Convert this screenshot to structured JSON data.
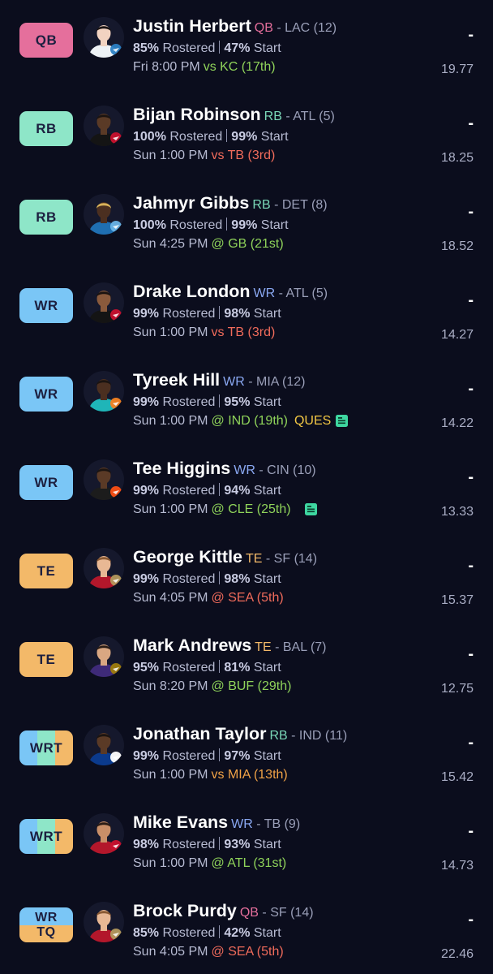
{
  "colors": {
    "QB": "#e56f9c",
    "RB": "#8ee6c8",
    "WR": "#7ac6f6",
    "TE": "#f3b969",
    "favorable": "#8fd35a",
    "neutral": "#f0a246",
    "unfavorable": "#f06b5b",
    "pos_text": {
      "QB": "#e56f9c",
      "RB": "#7ad8b8",
      "WR": "#8aa8f2",
      "TE": "#f3b969"
    }
  },
  "players": [
    {
      "slot": [
        "QB"
      ],
      "slot_colors": [
        "#e56f9c"
      ],
      "name": "Justin Herbert",
      "pos": "QB",
      "team": " - LAC (12)",
      "rostered_pct": "85%",
      "rostered_label": " Rostered",
      "start_pct": "47%",
      "start_label": " Start",
      "game_time": "Fri 8:00 PM",
      "matchup": "vs KC (17th)",
      "matchup_tier": "favorable",
      "injury": "",
      "news": false,
      "dash": "-",
      "projection": "19.77",
      "avatar": {
        "skin": "#f2d3c1",
        "hair": "#1a1414",
        "jersey": "#eef2f6",
        "logo": "bolt-logo-icon",
        "logo_color": "#2a80c4"
      }
    },
    {
      "slot": [
        "RB"
      ],
      "slot_colors": [
        "#8ee6c8"
      ],
      "name": "Bijan Robinson",
      "pos": "RB",
      "team": " - ATL (5)",
      "rostered_pct": "100%",
      "rostered_label": " Rostered",
      "start_pct": "99%",
      "start_label": " Start",
      "game_time": "Sun 1:00 PM",
      "matchup": "vs TB (3rd)",
      "matchup_tier": "unfavorable",
      "injury": "",
      "news": false,
      "dash": "-",
      "projection": "18.25",
      "avatar": {
        "skin": "#5a3a26",
        "hair": "#1b1411",
        "jersey": "#141414",
        "logo": "falcon-logo-icon",
        "logo_color": "#c8102e"
      }
    },
    {
      "slot": [
        "RB"
      ],
      "slot_colors": [
        "#8ee6c8"
      ],
      "name": "Jahmyr Gibbs",
      "pos": "RB",
      "team": " - DET (8)",
      "rostered_pct": "100%",
      "rostered_label": " Rostered",
      "start_pct": "99%",
      "start_label": " Start",
      "game_time": "Sun 4:25 PM",
      "matchup": "@ GB (21st)",
      "matchup_tier": "favorable",
      "injury": "",
      "news": false,
      "dash": "-",
      "projection": "18.52",
      "avatar": {
        "skin": "#4b2f20",
        "hair": "#d8b25a",
        "jersey": "#1f6fb2",
        "logo": "lion-logo-icon",
        "logo_color": "#69b3e7"
      }
    },
    {
      "slot": [
        "WR"
      ],
      "slot_colors": [
        "#7ac6f6"
      ],
      "name": "Drake London",
      "pos": "WR",
      "team": " - ATL (5)",
      "rostered_pct": "99%",
      "rostered_label": " Rostered",
      "start_pct": "98%",
      "start_label": " Start",
      "game_time": "Sun 1:00 PM",
      "matchup": "vs TB (3rd)",
      "matchup_tier": "unfavorable",
      "injury": "",
      "news": false,
      "dash": "-",
      "projection": "14.27",
      "avatar": {
        "skin": "#8a5a3c",
        "hair": "#1b1411",
        "jersey": "#141414",
        "logo": "falcon-logo-icon",
        "logo_color": "#c8102e"
      }
    },
    {
      "slot": [
        "WR"
      ],
      "slot_colors": [
        "#7ac6f6"
      ],
      "name": "Tyreek Hill",
      "pos": "WR",
      "team": " - MIA (12)",
      "rostered_pct": "99%",
      "rostered_label": " Rostered",
      "start_pct": "95%",
      "start_label": " Start",
      "game_time": "Sun 1:00 PM",
      "matchup": "@ IND (19th)",
      "matchup_tier": "favorable",
      "injury": "QUES",
      "news": true,
      "dash": "-",
      "projection": "14.22",
      "avatar": {
        "skin": "#4b2f20",
        "hair": "#1b1411",
        "jersey": "#1fb5b8",
        "logo": "dolphin-logo-icon",
        "logo_color": "#f58220"
      }
    },
    {
      "slot": [
        "WR"
      ],
      "slot_colors": [
        "#7ac6f6"
      ],
      "name": "Tee Higgins",
      "pos": "WR",
      "team": " - CIN (10)",
      "rostered_pct": "99%",
      "rostered_label": " Rostered",
      "start_pct": "94%",
      "start_label": " Start",
      "game_time": "Sun 1:00 PM",
      "matchup": "@ CLE (25th)",
      "matchup_tier": "favorable",
      "injury": "",
      "news": true,
      "dash": "-",
      "projection": "13.33",
      "avatar": {
        "skin": "#5a3a26",
        "hair": "#1b1411",
        "jersey": "#1c1c1c",
        "logo": "bengal-logo-icon",
        "logo_color": "#fb4f14"
      }
    },
    {
      "slot": [
        "TE"
      ],
      "slot_colors": [
        "#f3b969"
      ],
      "name": "George Kittle",
      "pos": "TE",
      "team": " - SF (14)",
      "rostered_pct": "99%",
      "rostered_label": " Rostered",
      "start_pct": "98%",
      "start_label": " Start",
      "game_time": "Sun 4:05 PM",
      "matchup": "@ SEA (5th)",
      "matchup_tier": "unfavorable",
      "injury": "",
      "news": false,
      "dash": "-",
      "projection": "15.37",
      "avatar": {
        "skin": "#e8b894",
        "hair": "#8a5a33",
        "jersey": "#b3172b",
        "logo": "sf-logo-icon",
        "logo_color": "#b3995d"
      }
    },
    {
      "slot": [
        "TE"
      ],
      "slot_colors": [
        "#f3b969"
      ],
      "name": "Mark Andrews",
      "pos": "TE",
      "team": " - BAL (7)",
      "rostered_pct": "95%",
      "rostered_label": " Rostered",
      "start_pct": "81%",
      "start_label": " Start",
      "game_time": "Sun 8:20 PM",
      "matchup": "@ BUF (29th)",
      "matchup_tier": "favorable",
      "injury": "",
      "news": false,
      "dash": "-",
      "projection": "12.75",
      "avatar": {
        "skin": "#d9a782",
        "hair": "#2b1d16",
        "jersey": "#3e2a78",
        "logo": "raven-logo-icon",
        "logo_color": "#9e7c0c"
      }
    },
    {
      "slot": [
        "W",
        "R",
        "T"
      ],
      "slot_colors": [
        "#7ac6f6",
        "#8ee6c8",
        "#f3b969"
      ],
      "name": "Jonathan Taylor",
      "pos": "RB",
      "team": " - IND (11)",
      "rostered_pct": "99%",
      "rostered_label": " Rostered",
      "start_pct": "97%",
      "start_label": " Start",
      "game_time": "Sun 1:00 PM",
      "matchup": "vs MIA (13th)",
      "matchup_tier": "neutral",
      "injury": "",
      "news": false,
      "dash": "-",
      "projection": "15.42",
      "avatar": {
        "skin": "#5a3a26",
        "hair": "#1b1411",
        "jersey": "#0b3a8c",
        "logo": "horseshoe-logo-icon",
        "logo_color": "#ffffff"
      }
    },
    {
      "slot": [
        "W",
        "R",
        "T"
      ],
      "slot_colors": [
        "#7ac6f6",
        "#8ee6c8",
        "#f3b969"
      ],
      "name": "Mike Evans",
      "pos": "WR",
      "team": " - TB (9)",
      "rostered_pct": "98%",
      "rostered_label": " Rostered",
      "start_pct": "93%",
      "start_label": " Start",
      "game_time": "Sun 1:00 PM",
      "matchup": "@ ATL (31st)",
      "matchup_tier": "favorable",
      "injury": "",
      "news": false,
      "dash": "-",
      "projection": "14.73",
      "avatar": {
        "skin": "#c98f68",
        "hair": "#2b1d16",
        "jersey": "#b3172b",
        "logo": "buccaneer-logo-icon",
        "logo_color": "#c8102e"
      }
    },
    {
      "slot": [
        "WR",
        "TQ"
      ],
      "slot_colors": [
        "#7ac6f6",
        "#f3b969"
      ],
      "name": "Brock Purdy",
      "pos": "QB",
      "team": " - SF (14)",
      "rostered_pct": "85%",
      "rostered_label": " Rostered",
      "start_pct": "42%",
      "start_label": " Start",
      "game_time": "Sun 4:05 PM",
      "matchup": "@ SEA (5th)",
      "matchup_tier": "unfavorable",
      "injury": "",
      "news": false,
      "dash": "-",
      "projection": "22.46",
      "avatar": {
        "skin": "#e8b894",
        "hair": "#8a5a33",
        "jersey": "#b3172b",
        "logo": "sf-logo-icon",
        "logo_color": "#b3995d"
      }
    }
  ]
}
